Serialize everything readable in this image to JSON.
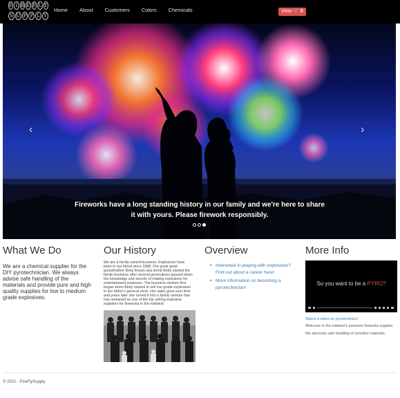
{
  "brand": {
    "line1": [
      "F",
      "I",
      "R",
      "E",
      "F",
      "L",
      "Y"
    ],
    "line2": [
      "S",
      "U",
      "P",
      "P",
      "L",
      "Y"
    ]
  },
  "nav": {
    "links": [
      "Home",
      "About",
      "Customers",
      "Colors",
      "Chemicals"
    ],
    "cart_label": "View",
    "cart_icon": "cart-icon",
    "cart_count": "0"
  },
  "carousel": {
    "caption_line1": "Fireworks have a long standing history in our family and we're here to share",
    "caption_line2": "it with yours. Please firework responsibly.",
    "prev_icon": "‹",
    "next_icon": "›",
    "active_slide": 3,
    "slide_count": 3
  },
  "what_we_do": {
    "title": "What We Do",
    "text": "We are a chemical supplier for the DIY pyrotechnician. We always advise safe handling of the materials and provide pure and high quality supplies for low to medium grade explosives."
  },
  "history": {
    "title": "Our History",
    "text": "We are a family owned business. Explosives have been in our blood since 1898. Our great great grandmother Betty Brown aka bomb Betty started the family business after several generations passed down the knowledge and secrets of making explosives for entertainment purposes. The business venture first began when Betty started to sell low grade explosives in her father's general store. Her sales grew over time and years later she turned it into a family venture that has remained as one of the top selling explosive suppliers for fireworks in the midwest."
  },
  "overview": {
    "title": "Overview",
    "items": [
      "Interested in playing with explosives? Find out about a career here!",
      "More information on becoming a pyrotechnician!"
    ]
  },
  "more_info": {
    "title": "More Info",
    "video_title_prefix": "So you want to be a ",
    "video_title_highlight": "PYRO?",
    "video_link": "Watch a video on pyrotechnics!",
    "welcome_text": "Welcome to the midwest's premiere fireworks supplier.",
    "safety_text": "We advocate safe handling of sensitive materials."
  },
  "footer": {
    "text": "© 2021 - FireFlySupply"
  },
  "colors": {
    "navbar": "#000000",
    "cart_button": "#d9534f",
    "link": "#337ab7"
  }
}
